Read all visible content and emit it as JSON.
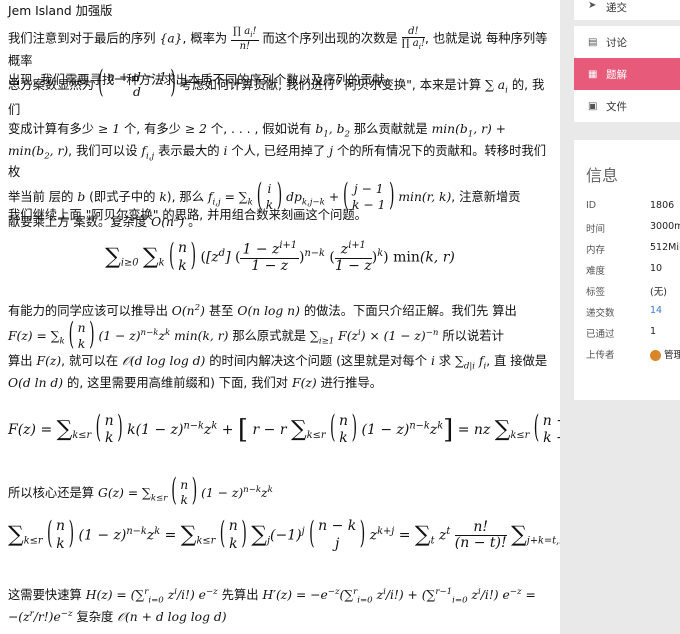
{
  "main": {
    "p0": "Jem Island 加强版",
    "p1a": "我们注意到对于最后的序列",
    "p1b": "概率为",
    "p1c": "而这个序列出现的次数是",
    "p1d": "也就是说 每种序列等概率",
    "p1e": "出现, 我们需要寻找一种方法求出本质不同的序列个数以及序列的贡献。",
    "p2a": "总方案数显然为",
    "p2b": "考虑如何计算贡献, 我们进行\" 阿贝尔变换\", 本来是计算",
    "p2c": "的, 我们",
    "p2d": "变成计算有多少",
    "p2e": "个, 有多少",
    "p2f": "个, . . . , 假如说有",
    "p2g": "那么贡献就是",
    "p2h": "我们可以设",
    "p2i": "表示最大的",
    "p2j": "个人, 已经用掉了",
    "p2k": "个的所有情况下的贡献和。转移时我们枚",
    "p2l": "举当前 层的",
    "p2m": "(即式子中的",
    "p2n": "), 那么",
    "p2o": "注意新增贡",
    "p2p": "献要乘上方 案数。复杂度",
    "p3": "我们继续上面 \"阿贝尔变换\" 的思路, 并用组合数来刻画这个问题。",
    "p4a": "有能力的同学应该可以推导出",
    "p4b": "甚至",
    "p4c": "的做法。下面只介绍正解。我们先 算出",
    "p4d": "那么原式就是",
    "p4e": "所以说若计",
    "p4f": "算出",
    "p4g": "就可以在",
    "p4h": "的时间内解决这个问题 (这里就是对每个",
    "p4i": "求",
    "p4j": "直 接做是",
    "p4k": "的, 这里需要用高维前缀和) 下面, 我们对",
    "p4l": "进行推导。",
    "p5a": "所以核心还是算",
    "p6a": "这需要快速算",
    "p6b": "先算出",
    "p6c": "复杂度"
  },
  "sidebar": {
    "submit_label": "递交",
    "discuss_label": "讨论",
    "solution_label": "题解",
    "files_label": "文件",
    "info_title": "信息",
    "rows": [
      {
        "key": "ID",
        "value": "1806"
      },
      {
        "key": "时间",
        "value": "3000ms"
      },
      {
        "key": "内存",
        "value": "512MiB"
      },
      {
        "key": "难度",
        "value": "10"
      },
      {
        "key": "标签",
        "value": "(无)"
      },
      {
        "key": "递交数",
        "value": "14"
      },
      {
        "key": "已通过",
        "value": "1"
      },
      {
        "key": "上传者",
        "value": "管理"
      }
    ]
  },
  "colors": {
    "active_nav": "#e85a7a",
    "panel_bg": "#e9e9ea",
    "link": "#3a7bd5"
  },
  "icons": {
    "submit": "send-icon",
    "discuss": "comment-icon",
    "solution": "book-icon",
    "files": "file-icon"
  }
}
